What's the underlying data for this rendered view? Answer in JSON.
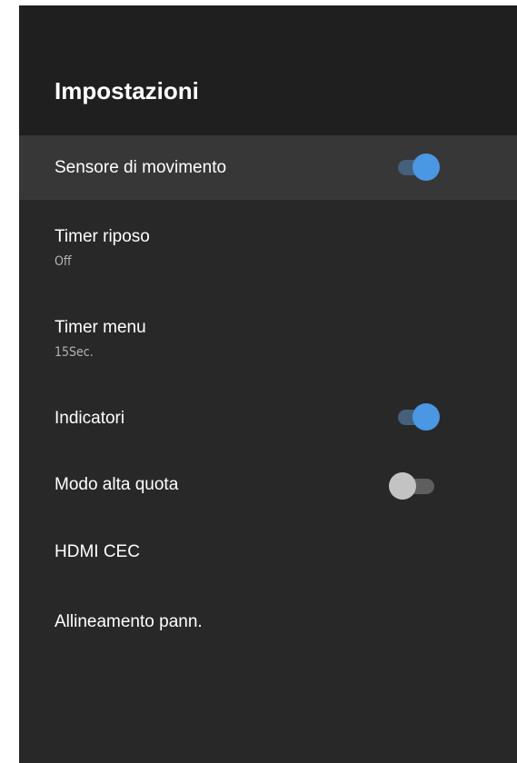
{
  "header": {
    "title": "Impostazioni"
  },
  "settings": {
    "items": [
      {
        "title": "Sensore di movimento",
        "toggle": "on"
      },
      {
        "title": "Timer riposo",
        "subtitle": "Off"
      },
      {
        "title": "Timer menu",
        "subtitle": "15Sec."
      },
      {
        "title": "Indicatori",
        "toggle": "on"
      },
      {
        "title": "Modo alta quota",
        "toggle": "off"
      },
      {
        "title": "HDMI CEC"
      },
      {
        "title": "Allineamento pann."
      }
    ]
  },
  "colors": {
    "toggle_on_thumb": "#4a97e3",
    "toggle_on_track": "#44607a",
    "toggle_off_thumb": "#c3c3c3",
    "toggle_off_track": "#5e5e5e",
    "panel_background": "#282828",
    "header_background": "#1f1f1f",
    "focused_row_background": "#373737"
  }
}
